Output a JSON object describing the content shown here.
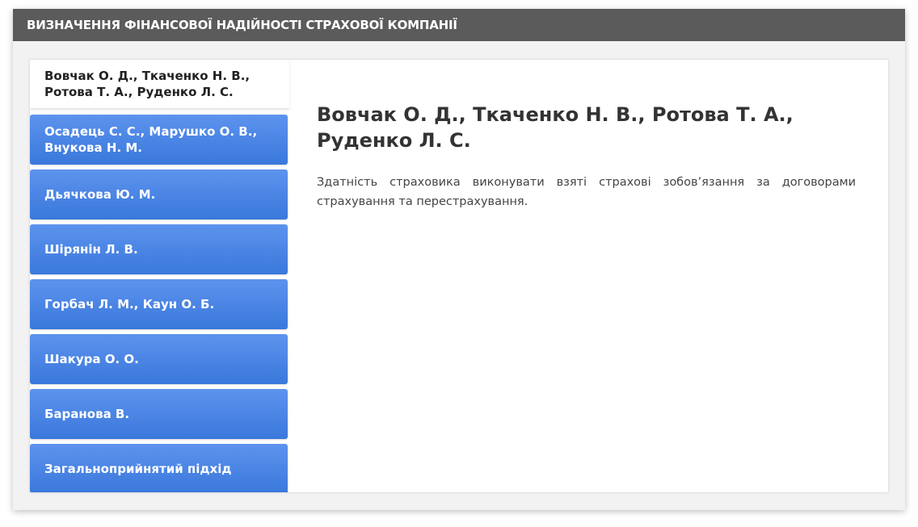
{
  "header": {
    "title": "ВИЗНАЧЕННЯ ФІНАНСОВОЇ НАДІЙНОСТІ СТРАХОВОЇ КОМПАНІЇ"
  },
  "tabs": [
    {
      "label": "Вовчак О. Д., Ткаченко Н. В., Ротова Т. А., Руденко Л. С.",
      "active": true
    },
    {
      "label": "Осадець С. С., Марушко О. В., Внукова Н. М.",
      "active": false
    },
    {
      "label": "Дьячкова Ю. М.",
      "active": false
    },
    {
      "label": "Шірянін Л. В.",
      "active": false
    },
    {
      "label": "Горбач Л. М., Каун О. Б.",
      "active": false
    },
    {
      "label": "Шакура О. О.",
      "active": false
    },
    {
      "label": "Баранова В.",
      "active": false
    },
    {
      "label": "Загальноприйнятий підхід",
      "active": false
    }
  ],
  "content": {
    "title": "Вовчак О. Д., Ткаченко Н. В., Ротова Т. А., Руденко Л. С.",
    "text": "Здатність страховика виконувати взяті страхові зобов’язання за договорами страхування та перестрахування."
  },
  "colors": {
    "header_bg": "#5b5b5b",
    "tab_blue": "#4a86e8",
    "active_tab_bg": "#ffffff"
  }
}
